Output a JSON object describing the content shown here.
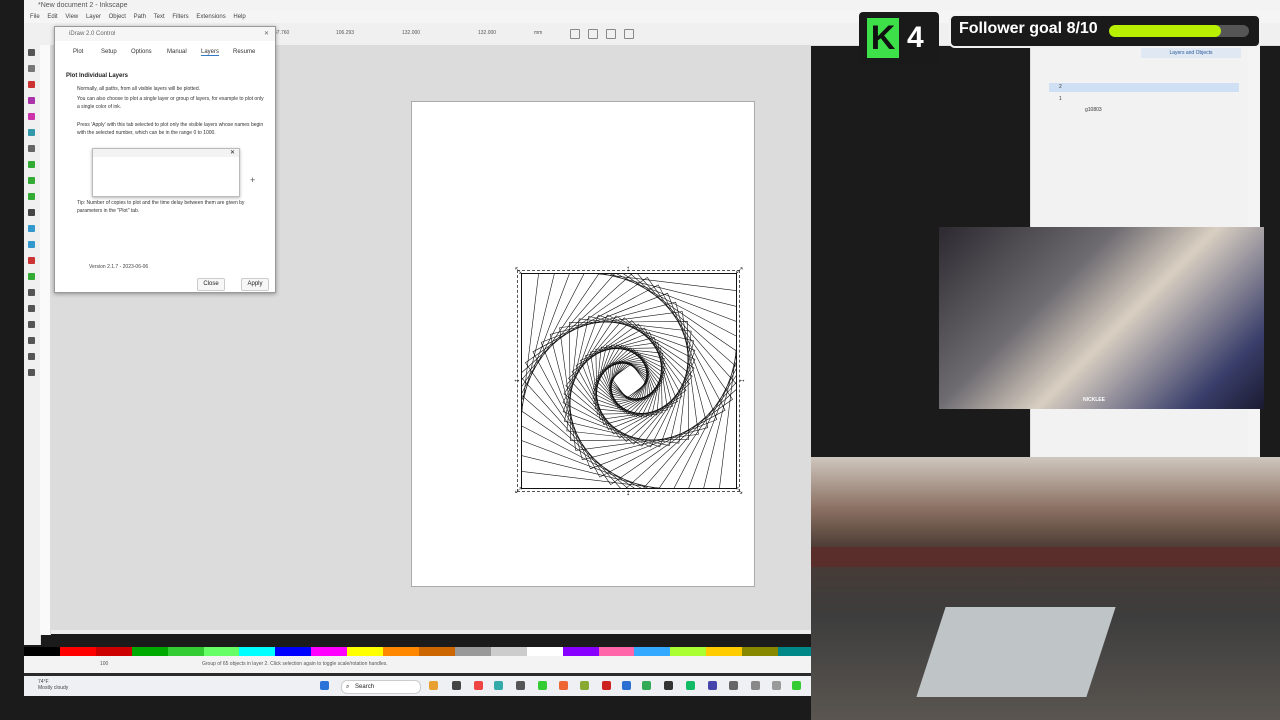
{
  "window": {
    "title": "*New document 2 - Inkscape",
    "menu": [
      "File",
      "Edit",
      "View",
      "Layer",
      "Object",
      "Path",
      "Text",
      "Filters",
      "Extensions",
      "Help"
    ]
  },
  "toolbar": {
    "x_value": "47.760",
    "y_value": "106.293",
    "w_value": "132.000",
    "h_value": "132.000",
    "unit": "mm"
  },
  "dialog": {
    "title": "iDraw 2.0 Control",
    "tabs": [
      "Plot",
      "Setup",
      "Options",
      "Manual",
      "Layers",
      "Resume"
    ],
    "active_tab": "Layers",
    "heading": "Plot Individual Layers",
    "paragraphs": [
      "Normally, all paths, from all visible layers will be plotted.",
      "You can also choose to plot a single layer or group of layers, for example to plot only a single color of ink.",
      "Press 'Apply' with this tab selected to plot only the visible layers whose names begin with the selected number, which can be in the range 0 to 1000.",
      "Tip: Number of copies to plot and the time delay between them are given by parameters in the \"Plot\" tab."
    ],
    "version": "Version 2.1.7 - 2023-06-06",
    "close_label": "Close",
    "apply_label": "Apply"
  },
  "layers_panel": {
    "tab_label": "Layers and Objects",
    "rows": [
      "2",
      "1",
      "g10803"
    ]
  },
  "statusbar": {
    "text": "Group of 65 objects in layer 2. Click selection again to toggle scale/rotation handles.",
    "zoom": "100"
  },
  "taskbar": {
    "weather_temp": "74°F",
    "weather_desc": "Mostly cloudy",
    "search_placeholder": "Search"
  },
  "overlay": {
    "badge_number": "4",
    "badge_letter": "K",
    "follower_goal": "Follower goal 8/10",
    "goal_current": 8,
    "goal_target": 10,
    "cam_label": "NICKLEE",
    "goal_color": "#b8f000"
  },
  "palette": [
    "#000000",
    "#ff0000",
    "#cc0000",
    "#00aa00",
    "#33cc33",
    "#66ff66",
    "#00ffff",
    "#0000ff",
    "#ff00ff",
    "#ffff00",
    "#ff8800",
    "#cc6600",
    "#999999",
    "#cccccc",
    "#ffffff",
    "#8800ff",
    "#ff66aa",
    "#33aaff",
    "#aaff33",
    "#ffcc00",
    "#888800",
    "#008888"
  ]
}
